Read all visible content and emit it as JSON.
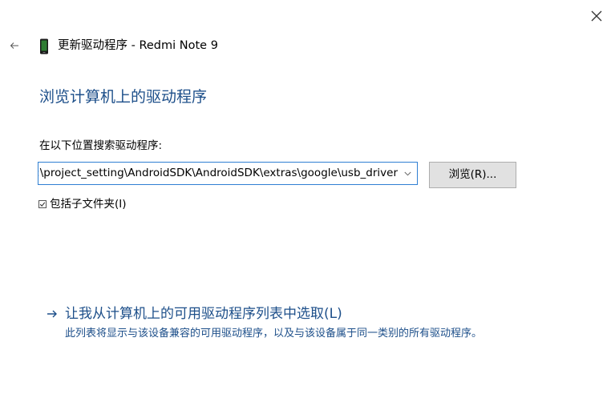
{
  "header": {
    "close_icon": "close-icon",
    "back_icon": "back-arrow-icon",
    "device_icon": "phone-icon",
    "title": "更新驱动程序 - Redmi Note 9"
  },
  "main": {
    "heading": "浏览计算机上的驱动程序",
    "search_label": "在以下位置搜索驱动程序:",
    "path_value": "D:\\project_setting\\AndroidSDK\\AndroidSDK\\extras\\google\\usb_driver",
    "browse_label": "浏览(R)...",
    "include_subfolders": {
      "label": "包括子文件夹(I)",
      "checked": true
    },
    "pick_option": {
      "title": "让我从计算机上的可用驱动程序列表中选取(L)",
      "description": "此列表将显示与该设备兼容的可用驱动程序，以及与该设备属于同一类别的所有驱动程序。"
    }
  },
  "colors": {
    "accent_blue": "#1d4f8a",
    "focus_border": "#2f7fd3",
    "button_bg": "#e1e1e1"
  }
}
